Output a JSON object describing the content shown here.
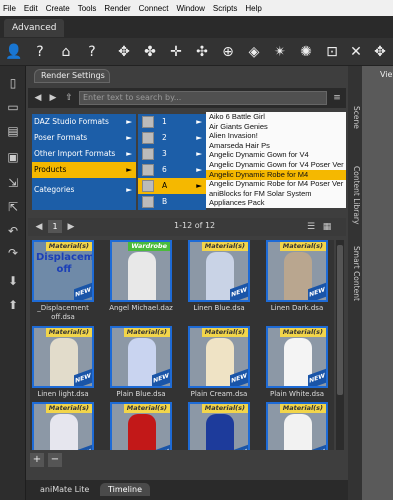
{
  "menu": [
    "File",
    "Edit",
    "Create",
    "Tools",
    "Render",
    "Connect",
    "Window",
    "Scripts",
    "Help"
  ],
  "tab": "Advanced",
  "render_tab": "Render Settings",
  "search": {
    "placeholder": "Enter text to search by..."
  },
  "categories": [
    {
      "label": "DAZ Studio Formats",
      "arrow": "►"
    },
    {
      "label": "Poser Formats",
      "arrow": "►"
    },
    {
      "label": "Other Import Formats",
      "arrow": "►"
    },
    {
      "label": "Products",
      "arrow": "►",
      "selected": true
    },
    {
      "label": "Categories",
      "arrow": "►"
    }
  ],
  "subfolders": [
    {
      "label": "1",
      "arrow": "►"
    },
    {
      "label": "2",
      "arrow": "►"
    },
    {
      "label": "3",
      "arrow": "►"
    },
    {
      "label": "6",
      "arrow": "►"
    },
    {
      "label": "A",
      "arrow": "►",
      "selected": true
    },
    {
      "label": "B",
      "arrow": ""
    }
  ],
  "products": [
    "Aiko 6 Battle Girl",
    "Air Giants Genies",
    "Alien Invasion!",
    "Amarseda Hair Ps",
    "Angelic Dynamic Gown for V4",
    "Angelic Dynamic Gown for V4 Poser Ver",
    "Angelic Dynamic Robe for M4",
    "Angelic Dynamic Robe for M4 Poser Ver",
    "aniBlocks for FM Solar System",
    "Appliances Pack"
  ],
  "selected_product_index": 6,
  "page": "1",
  "count": "1-12 of 12",
  "thumbnails": [
    {
      "badge": "Material(s)",
      "label": "_Displacement off.dsa",
      "disp": "Displacement off",
      "color": "#6f8aa8"
    },
    {
      "badge": "Wardrobe",
      "label": "Angel Michael.daz",
      "color": "#e8e8e8"
    },
    {
      "badge": "Material(s)",
      "label": "Linen Blue.dsa",
      "color": "#c9d3e6"
    },
    {
      "badge": "Material(s)",
      "label": "Linen Dark.dsa",
      "color": "#b9a68f"
    },
    {
      "badge": "Material(s)",
      "label": "Linen light.dsa",
      "color": "#e2dccb"
    },
    {
      "badge": "Material(s)",
      "label": "Plain Blue.dsa",
      "color": "#c9d4f0"
    },
    {
      "badge": "Material(s)",
      "label": "Plain Cream.dsa",
      "color": "#efe3c5"
    },
    {
      "badge": "Material(s)",
      "label": "Plain White.dsa",
      "color": "#f4f4f4"
    },
    {
      "badge": "Material(s)",
      "label": "",
      "color": "#e6e6ee"
    },
    {
      "badge": "Material(s)",
      "label": "",
      "color": "#c21818"
    },
    {
      "badge": "Material(s)",
      "label": "",
      "color": "#1d3b9b"
    },
    {
      "badge": "Material(s)",
      "label": "",
      "color": "#f2f2f2"
    }
  ],
  "new_badge": "NEW",
  "side_tabs": [
    "Scene",
    "Content Library",
    "Smart Content"
  ],
  "viewport_label": "View",
  "bottom_tabs": [
    "aniMate Lite",
    "Timeline"
  ]
}
